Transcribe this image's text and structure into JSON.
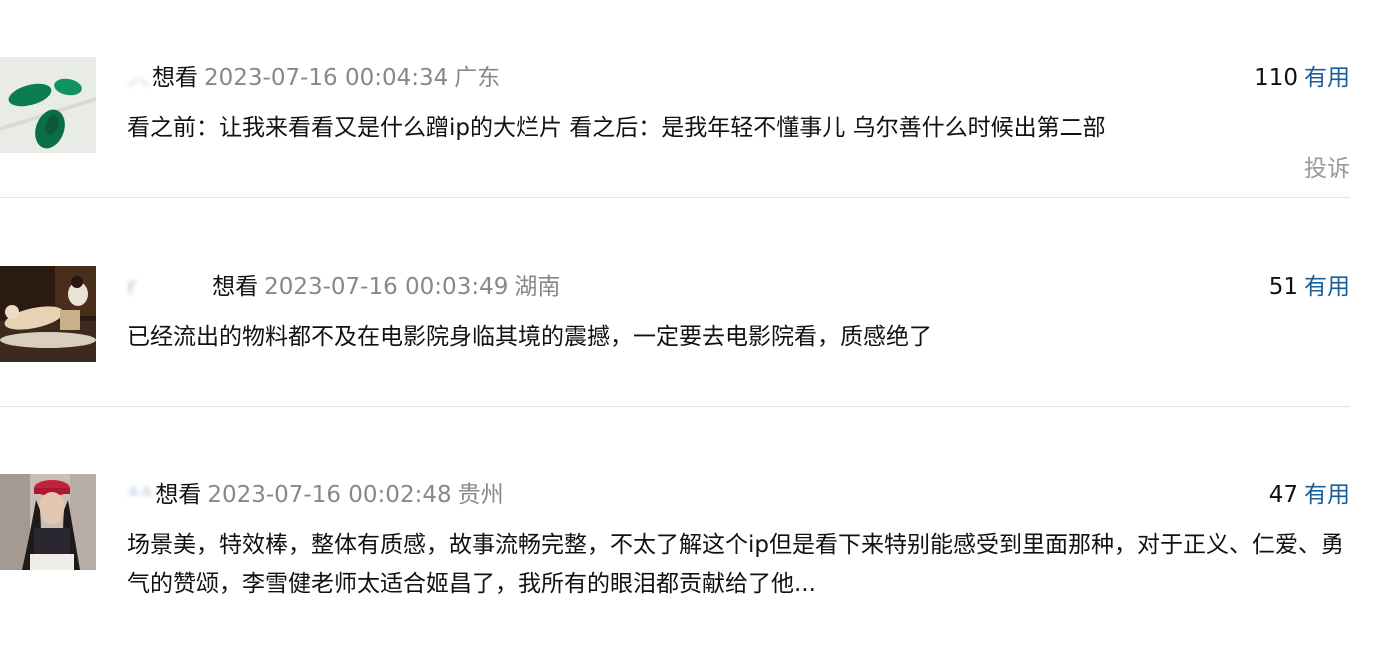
{
  "comments": [
    {
      "user": "⸝⸜",
      "status": "想看",
      "time": "2023-07-16 00:04:34",
      "location": "广东",
      "votes": "110",
      "useful_label": "有用",
      "text": "看之前：让我来看看又是什么蹭ip的大烂片 看之后：是我年轻不懂事儿 乌尔善什么时候出第二部",
      "report_label": "投诉"
    },
    {
      "user": "r    ",
      "status": "想看",
      "time": "2023-07-16 00:03:49",
      "location": "湖南",
      "votes": "51",
      "useful_label": "有用",
      "text": "已经流出的物料都不及在电影院身临其境的震撼，一定要去电影院看，质感绝了"
    },
    {
      "user": "⸛⸛",
      "status": "想看",
      "time": "2023-07-16 00:02:48",
      "location": "贵州",
      "votes": "47",
      "useful_label": "有用",
      "text": "场景美，特效棒，整体有质感，故事流畅完整，不太了解这个ip但是看下来特别能感受到里面那种，对于正义、仁爱、勇气的赞颂，李雪健老师太适合姬昌了，我所有的眼泪都贡献给了他..."
    }
  ],
  "colors": {
    "link": "#1a5d9c",
    "muted": "#888888",
    "divider": "#e3e3e3"
  }
}
